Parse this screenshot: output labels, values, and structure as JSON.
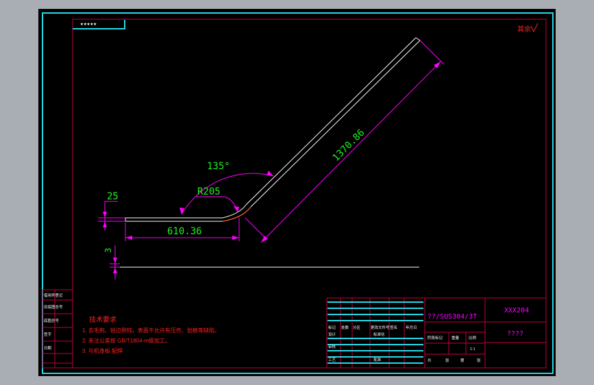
{
  "colors": {
    "viewport_bg": "#a9aeb4",
    "canvas_bg": "#000000",
    "frame": "#26d9e8",
    "border": "#c4003a",
    "dimension": "#ff00ff",
    "dimension_text": "#22ee22",
    "part": "#ffffff",
    "note_text": "#ff2020"
  },
  "drawing": {
    "corner_tag": "★★★★★",
    "roughness_mark": "其余",
    "dim_thickness": "25",
    "dim_angle": "135°",
    "dim_radius": "R205",
    "dim_short_length": "610.36",
    "dim_long_length": "1370.86",
    "dim_gap": "3"
  },
  "notes": {
    "title": "技术要求",
    "items": [
      "1. 去毛刺、锐边倒钝，表面不允许有压伤、划痕等缺陷。",
      "2. 未注公差按 GB/T1804-m级加工。",
      "3. 与机身板 配焊"
    ]
  },
  "title_block": {
    "material": "??/SUS304/3T",
    "drawing_no": "XXX204",
    "part_name": "????",
    "scale": "1:1",
    "rev_headers": [
      "标记",
      "处数",
      "分区",
      "更改文件号",
      "签名",
      "年月日"
    ],
    "sign_rows": [
      "设计",
      "审核",
      "工艺"
    ],
    "sign_extra": [
      "标准化",
      "批准"
    ],
    "stage_headers": [
      "阶段标记",
      "重量",
      "比例"
    ],
    "page_info": [
      "共",
      "张",
      "第",
      "张"
    ]
  },
  "side_strip": [
    "借用件登记",
    "旧底图总号",
    "底图总号",
    "签字",
    "日期"
  ]
}
